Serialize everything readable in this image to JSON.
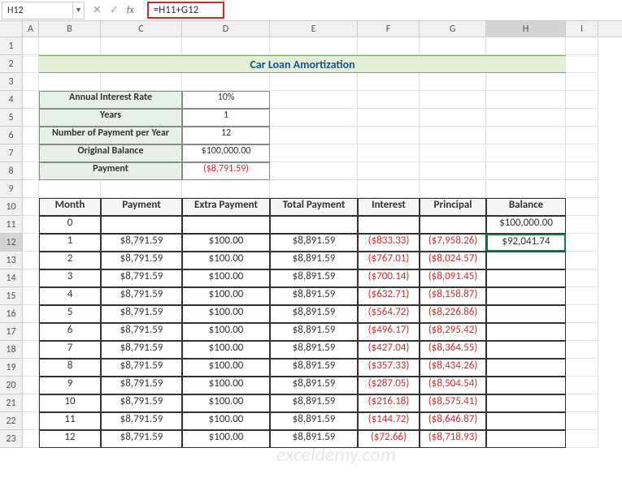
{
  "nameBox": "H12",
  "formula": "=H11+G12",
  "columns": [
    "A",
    "B",
    "C",
    "D",
    "E",
    "F",
    "G",
    "H",
    "I"
  ],
  "title": "Car Loan Amortization",
  "params": {
    "rate_label": "Annual Interest Rate",
    "rate_val": "10%",
    "years_label": "Years",
    "years_val": "1",
    "npy_label": "Number of Payment per Year",
    "npy_val": "12",
    "orig_label": "Original Balance",
    "orig_val": "$100,000.00",
    "pmt_label": "Payment",
    "pmt_val": "($8,791.59)"
  },
  "headers": {
    "month": "Month",
    "payment": "Payment",
    "extra": "Extra Payment",
    "total": "Total Payment",
    "interest": "Interest",
    "principal": "Principal",
    "balance": "Balance"
  },
  "row0": {
    "month": "0",
    "balance": "$100,000.00"
  },
  "tableRows": [
    {
      "m": "1",
      "pay": "$8,791.59",
      "extra": "$100.00",
      "total": "$8,891.59",
      "int": "($833.33)",
      "prin": "($7,958.26)",
      "bal": "$92,041.74"
    },
    {
      "m": "2",
      "pay": "$8,791.59",
      "extra": "$100.00",
      "total": "$8,891.59",
      "int": "($767.01)",
      "prin": "($8,024.57)",
      "bal": ""
    },
    {
      "m": "3",
      "pay": "$8,791.59",
      "extra": "$100.00",
      "total": "$8,891.59",
      "int": "($700.14)",
      "prin": "($8,091.45)",
      "bal": ""
    },
    {
      "m": "4",
      "pay": "$8,791.59",
      "extra": "$100.00",
      "total": "$8,891.59",
      "int": "($632.71)",
      "prin": "($8,158.87)",
      "bal": ""
    },
    {
      "m": "5",
      "pay": "$8,791.59",
      "extra": "$100.00",
      "total": "$8,891.59",
      "int": "($564.72)",
      "prin": "($8,226.86)",
      "bal": ""
    },
    {
      "m": "6",
      "pay": "$8,791.59",
      "extra": "$100.00",
      "total": "$8,891.59",
      "int": "($496.17)",
      "prin": "($8,295.42)",
      "bal": ""
    },
    {
      "m": "7",
      "pay": "$8,791.59",
      "extra": "$100.00",
      "total": "$8,891.59",
      "int": "($427.04)",
      "prin": "($8,364.55)",
      "bal": ""
    },
    {
      "m": "8",
      "pay": "$8,791.59",
      "extra": "$100.00",
      "total": "$8,891.59",
      "int": "($357.33)",
      "prin": "($8,434.26)",
      "bal": ""
    },
    {
      "m": "9",
      "pay": "$8,791.59",
      "extra": "$100.00",
      "total": "$8,891.59",
      "int": "($287.05)",
      "prin": "($8,504.54)",
      "bal": ""
    },
    {
      "m": "10",
      "pay": "$8,791.59",
      "extra": "$100.00",
      "total": "$8,891.59",
      "int": "($216.18)",
      "prin": "($8,575.41)",
      "bal": ""
    },
    {
      "m": "11",
      "pay": "$8,791.59",
      "extra": "$100.00",
      "total": "$8,891.59",
      "int": "($144.72)",
      "prin": "($8,646.87)",
      "bal": ""
    },
    {
      "m": "12",
      "pay": "$8,791.59",
      "extra": "$100.00",
      "total": "$8,891.59",
      "int": "($72.66)",
      "prin": "($8,718.93)",
      "bal": ""
    }
  ],
  "watermark": "exceldemy.com",
  "chart_data": {
    "type": "table",
    "title": "Car Loan Amortization",
    "parameters": {
      "annual_interest_rate": 0.1,
      "years": 1,
      "payments_per_year": 12,
      "original_balance": 100000.0,
      "payment": -8791.59
    },
    "columns": [
      "Month",
      "Payment",
      "Extra Payment",
      "Total Payment",
      "Interest",
      "Principal",
      "Balance"
    ],
    "rows": [
      [
        0,
        null,
        null,
        null,
        null,
        null,
        100000.0
      ],
      [
        1,
        8791.59,
        100.0,
        8891.59,
        -833.33,
        -7958.26,
        92041.74
      ],
      [
        2,
        8791.59,
        100.0,
        8891.59,
        -767.01,
        -8024.57,
        null
      ],
      [
        3,
        8791.59,
        100.0,
        8891.59,
        -700.14,
        -8091.45,
        null
      ],
      [
        4,
        8791.59,
        100.0,
        8891.59,
        -632.71,
        -8158.87,
        null
      ],
      [
        5,
        8791.59,
        100.0,
        8891.59,
        -564.72,
        -8226.86,
        null
      ],
      [
        6,
        8791.59,
        100.0,
        8891.59,
        -496.17,
        -8295.42,
        null
      ],
      [
        7,
        8791.59,
        100.0,
        8891.59,
        -427.04,
        -8364.55,
        null
      ],
      [
        8,
        8791.59,
        100.0,
        8891.59,
        -357.33,
        -8434.26,
        null
      ],
      [
        9,
        8791.59,
        100.0,
        8891.59,
        -287.05,
        -8504.54,
        null
      ],
      [
        10,
        8791.59,
        100.0,
        8891.59,
        -216.18,
        -8575.41,
        null
      ],
      [
        11,
        8791.59,
        100.0,
        8891.59,
        -144.72,
        -8646.87,
        null
      ],
      [
        12,
        8791.59,
        100.0,
        8891.59,
        -72.66,
        -8718.93,
        null
      ]
    ]
  }
}
